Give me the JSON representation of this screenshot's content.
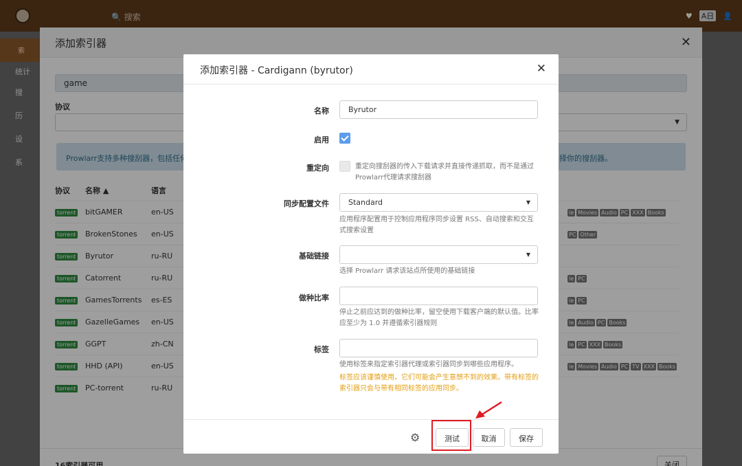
{
  "topbar": {
    "search_placeholder": "搜索",
    "lang_badge": "A日"
  },
  "sidebar": {
    "items": [
      "索",
      "统计",
      "搜",
      "历",
      "设",
      "系"
    ]
  },
  "outer_modal": {
    "title": "添加索引器",
    "filter_value": "game",
    "protocol_label": "协议",
    "info_text": "Prowlarr支持多种搜刮器，包括任何使",
    "info_text_right": "择你的搜刮器。",
    "columns": [
      "协议",
      "名称",
      "语言"
    ],
    "rows": [
      {
        "protocol": "torrent",
        "name": "bitGAMER",
        "lang": "en-US",
        "cats": [
          "le",
          "Movies",
          "Audio",
          "PC",
          "XXX",
          "Books"
        ]
      },
      {
        "protocol": "torrent",
        "name": "BrokenStones",
        "lang": "en-US",
        "cats": [
          "PC",
          "Other"
        ]
      },
      {
        "protocol": "torrent",
        "name": "Byrutor",
        "lang": "ru-RU",
        "cats": []
      },
      {
        "protocol": "torrent",
        "name": "Catorrent",
        "lang": "ru-RU",
        "cats": [
          "le",
          "PC"
        ]
      },
      {
        "protocol": "torrent",
        "name": "GamesTorrents",
        "lang": "es-ES",
        "cats": [
          "le",
          "PC"
        ]
      },
      {
        "protocol": "torrent",
        "name": "GazelleGames",
        "lang": "en-US",
        "cats": [
          "le",
          "Audio",
          "PC",
          "Books"
        ]
      },
      {
        "protocol": "torrent",
        "name": "GGPT",
        "lang": "zh-CN",
        "cats": [
          "le",
          "PC",
          "XXX",
          "Books"
        ]
      },
      {
        "protocol": "torrent",
        "name": "HHD (API)",
        "lang": "en-US",
        "cats": [
          "le",
          "Movies",
          "Audio",
          "PC",
          "TV",
          "XXX",
          "Books"
        ]
      },
      {
        "protocol": "torrent",
        "name": "PC-torrent",
        "lang": "ru-RU",
        "cats": []
      }
    ],
    "footer_count": "16索引器可用",
    "close_label": "关闭"
  },
  "dialog": {
    "title": "添加索引器 - Cardigann (byrutor)",
    "name_label": "名称",
    "name_value": "Byrutor",
    "enable_label": "启用",
    "redirect_label": "重定向",
    "redirect_help": "重定向搜刮器的传入下载请求并直接传递抓取，而不是通过Prowlarr代理请求搜刮器",
    "sync_label": "同步配置文件",
    "sync_value": "Standard",
    "sync_help": "应用程序配置用于控制应用程序同步设置 RSS、自动搜索和交互式搜索设置",
    "baseurl_label": "基础链接",
    "baseurl_help": "选择 Prowlarr 请求该站点所使用的基础链接",
    "seed_label": "做种比率",
    "seed_help": "停止之前应达到的做种比率，留空使用下载客户端的默认值。比率应至少为 1.0 并遵循索引器规则",
    "tags_label": "标签",
    "tags_help": "使用标签来指定索引器代理或索引器同步到哪些应用程序。",
    "tags_warn": "标签应该谨慎使用，它们可能会产生意想不到的效果。带有标签的索引器只会与带有相同标签的应用同步。",
    "test_label": "测试",
    "cancel_label": "取消",
    "save_label": "保存"
  }
}
